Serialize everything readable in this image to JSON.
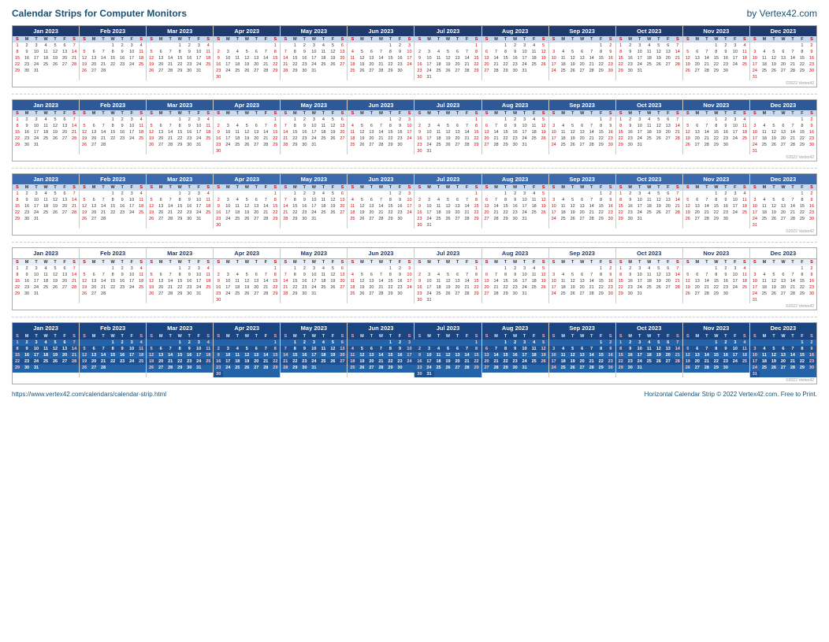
{
  "header": {
    "title": "Calendar Strips for Computer Monitors",
    "brand": "by Vertex42.com"
  },
  "footer": {
    "url": "https://www.vertex42.com/calendars/calendar-strip.html",
    "copyright": "Horizontal Calendar Strip © 2022 Vertex42.com. Free to Print."
  },
  "months": [
    "Jan 2023",
    "Feb 2023",
    "Mar 2023",
    "Apr 2023",
    "May 2023",
    "Jun 2023",
    "Jul 2023",
    "Aug 2023",
    "Sep 2023",
    "Oct 2023",
    "Nov 2023",
    "Dec 2023"
  ],
  "days_short": [
    "S",
    "M",
    "T",
    "W",
    "T",
    "F",
    "S"
  ],
  "watermark": "Vertex42.com",
  "copyright_small": "©2022 Vertex42"
}
